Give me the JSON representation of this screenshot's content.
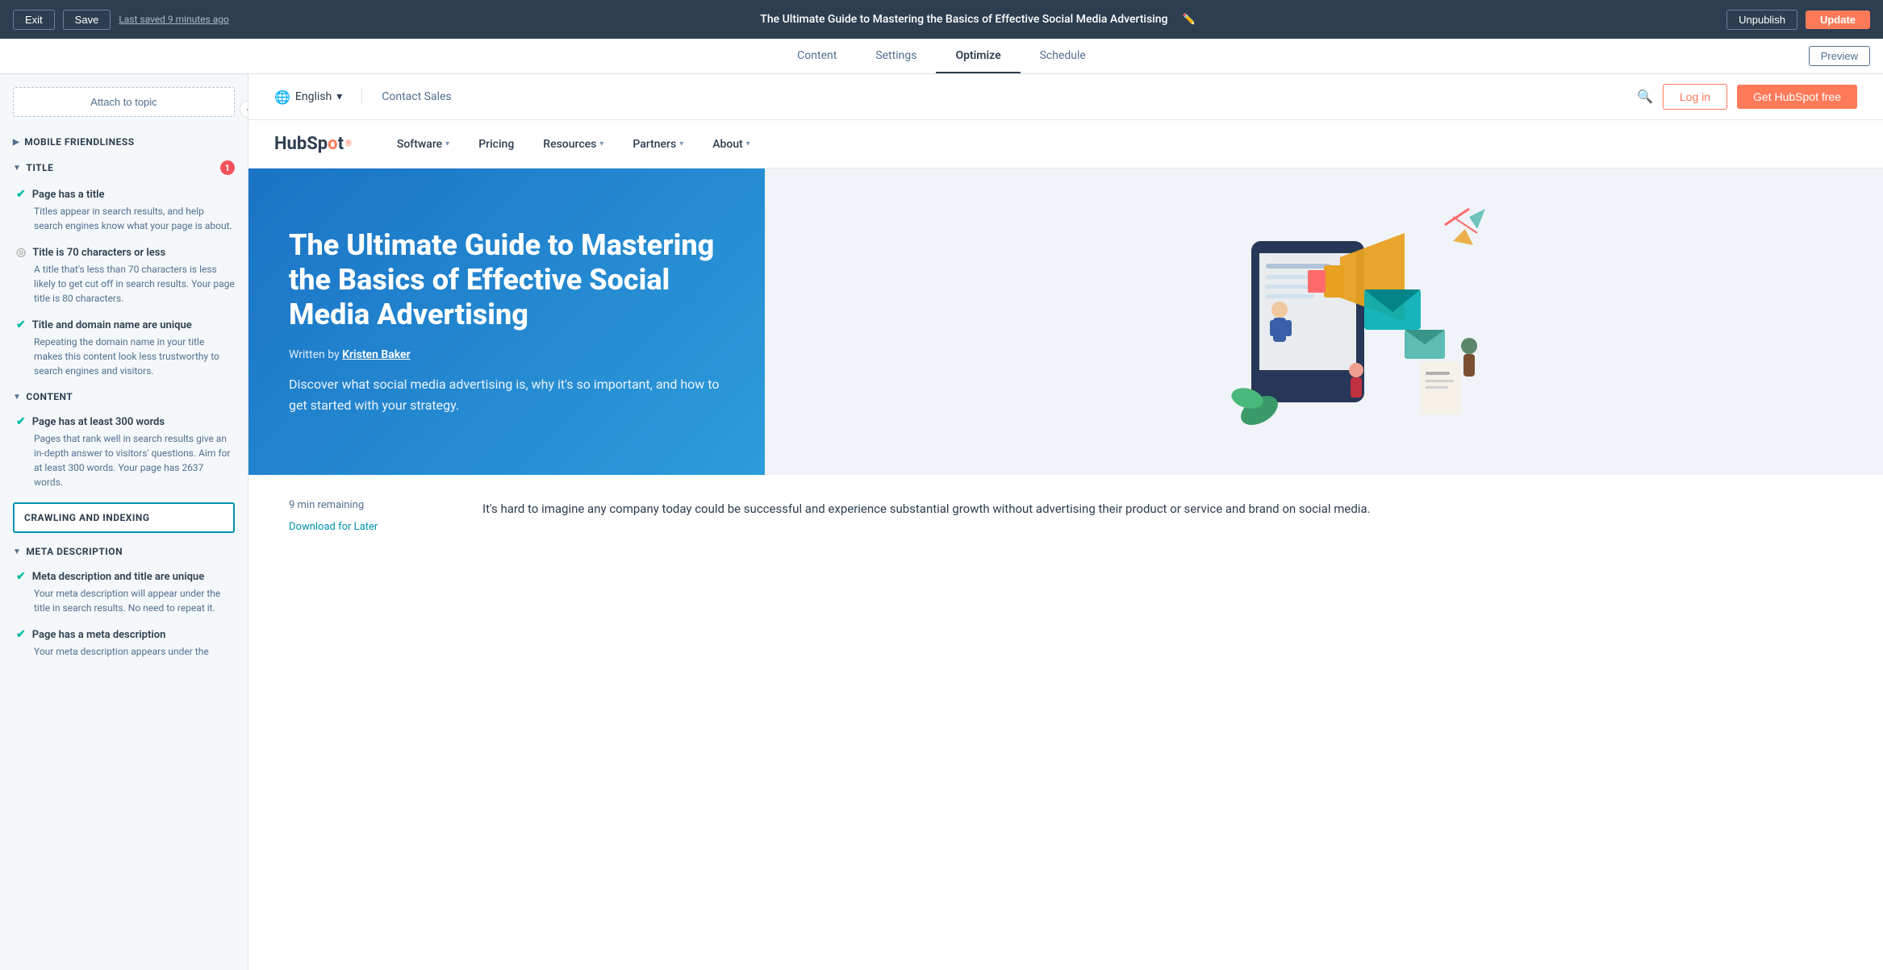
{
  "topBar": {
    "exit_label": "Exit",
    "save_label": "Save",
    "last_saved": "Last saved 9 minutes ago",
    "page_title": "The Ultimate Guide to Mastering the Basics of Effective Social Media Advertising",
    "unpublish_label": "Unpublish",
    "update_label": "Update",
    "preview_label": "Preview"
  },
  "editorTabs": {
    "tabs": [
      {
        "id": "content",
        "label": "Content"
      },
      {
        "id": "settings",
        "label": "Settings"
      },
      {
        "id": "optimize",
        "label": "Optimize",
        "active": true
      },
      {
        "id": "schedule",
        "label": "Schedule"
      }
    ]
  },
  "sidebar": {
    "attach_topic_label": "Attach to topic",
    "sections": {
      "mobile_friendliness": {
        "label": "MOBILE FRIENDLINESS",
        "collapsed": true
      },
      "title": {
        "label": "TITLE",
        "badge": "1",
        "items": [
          {
            "status": "green",
            "title": "Page has a title",
            "description": "Titles appear in search results, and help search engines know what your page is about."
          },
          {
            "status": "gray",
            "title": "Title is 70 characters or less",
            "description": "A title that's less than 70 characters is less likely to get cut off in search results. Your page title is 80 characters."
          },
          {
            "status": "green",
            "title": "Title and domain name are unique",
            "description": "Repeating the domain name in your title makes this content look less trustworthy to search engines and visitors."
          }
        ]
      },
      "content": {
        "label": "CONTENT",
        "items": [
          {
            "status": "green",
            "title": "Page has at least 300 words",
            "description": "Pages that rank well in search results give an in-depth answer to visitors' questions. Aim for at least 300 words. Your page has 2637 words."
          }
        ]
      },
      "crawling_indexing": {
        "label": "CRAWLING AND INDEXING"
      },
      "meta_description": {
        "label": "META DESCRIPTION",
        "items": [
          {
            "status": "green",
            "title": "Meta description and title are unique",
            "description": "Your meta description will appear under the title in search results. No need to repeat it."
          },
          {
            "status": "green",
            "title": "Page has a meta description",
            "description": "Your meta description appears under the"
          }
        ]
      }
    }
  },
  "siteHeader": {
    "language": "English",
    "contact_sales": "Contact Sales",
    "login_label": "Log in",
    "get_hubspot_label": "Get HubSpot free"
  },
  "siteNav": {
    "logo_text_hs": "HubSp",
    "logo_dot": "o",
    "logo_rest": "t",
    "nav_items": [
      {
        "label": "Software",
        "has_dropdown": true
      },
      {
        "label": "Pricing",
        "has_dropdown": false
      },
      {
        "label": "Resources",
        "has_dropdown": true
      },
      {
        "label": "Partners",
        "has_dropdown": true
      },
      {
        "label": "About",
        "has_dropdown": true
      }
    ]
  },
  "hero": {
    "title": "The Ultimate Guide to Mastering the Basics of Effective Social Media Advertising",
    "written_by_prefix": "Written by ",
    "author": "Kristen Baker",
    "description": "Discover what social media advertising is, why it's so important, and how to get started with your strategy."
  },
  "article": {
    "time_remaining": "9 min remaining",
    "download_later": "Download for Later",
    "excerpt": "It's hard to imagine any company today could be successful and experience substantial growth without advertising their product or service and brand on social media."
  }
}
